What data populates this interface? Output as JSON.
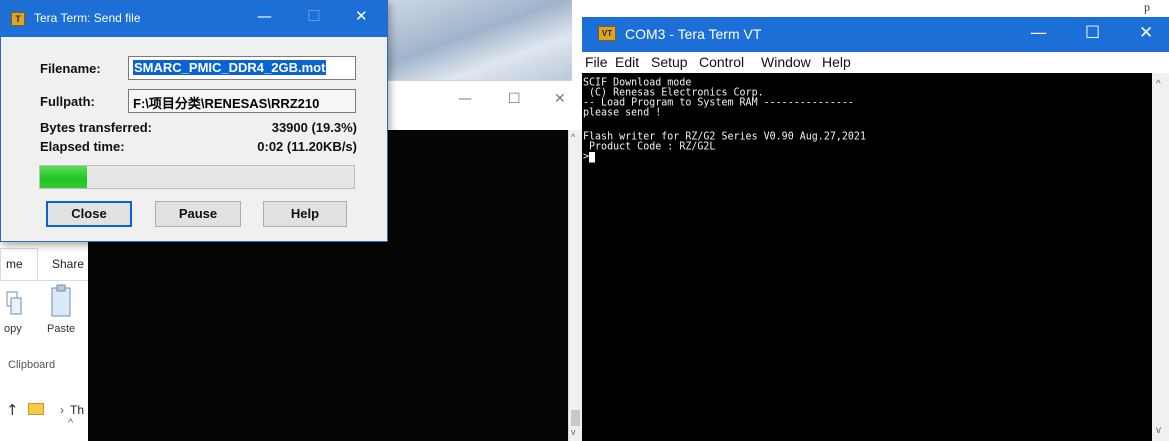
{
  "send_dialog": {
    "title": "Tera Term: Send file",
    "icon": "tera-term-icon",
    "filename_label": "Filename:",
    "filename_value": "SMARC_PMIC_DDR4_2GB.mot",
    "fullpath_label": "Fullpath:",
    "fullpath_value": "F:\\项目分类\\RENESAS\\RRZ210",
    "bytes_label": "Bytes transferred:",
    "bytes_value": "33900 (19.3%)",
    "elapsed_label": "Elapsed time:",
    "elapsed_value": "0:02 (11.20KB/s)",
    "progress_fraction": 0.15,
    "close_label": "Close",
    "pause_label": "Pause",
    "help_label": "Help",
    "minimize": "—",
    "maximize": "☐",
    "close": "✕"
  },
  "explorer": {
    "minimize": "—",
    "maximize": "☐",
    "close": "✕",
    "tab_home": "me",
    "tab_share": "Share",
    "copy_label": "opy",
    "paste_label": "Paste",
    "group_label": "Clipboard",
    "addr_up": "↑",
    "addr_sep": "›",
    "addr_text": "Th",
    "scroll_up": "^"
  },
  "vt": {
    "title": "COM3 - Tera Term VT",
    "icon": "tera-term-vt-icon",
    "minimize": "—",
    "maximize": "☐",
    "close": "✕",
    "menu": [
      "File",
      "Edit",
      "Setup",
      "Control",
      "Window",
      "Help"
    ],
    "terminal_lines": [
      "SCIF Download mode",
      " (C) Renesas Electronics Corp.",
      "-- Load Program to System RAM ---------------",
      "please send !",
      "",
      "Flash writer for RZ/G2 Series V0.90 Aug.27,2021",
      " Product Code : RZ/G2L",
      ">"
    ],
    "scroll_up": "^",
    "scroll_down": "v"
  },
  "corner_text": "p"
}
